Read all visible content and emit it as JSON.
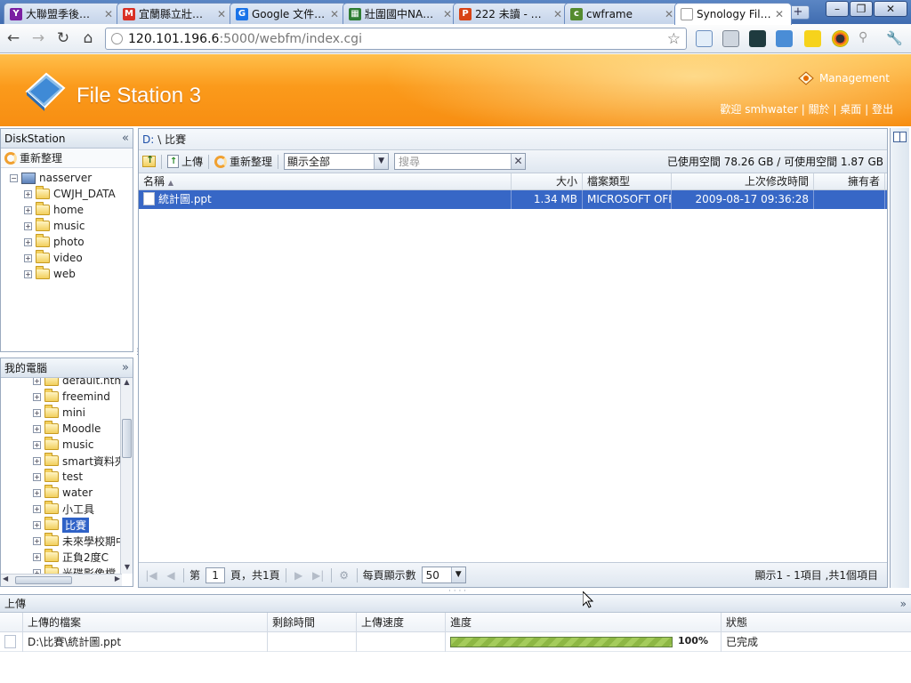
{
  "browser": {
    "tabs": [
      {
        "title": "大聯盟季後…",
        "favicon": "yahoo-icon",
        "color": "#7b1fa2"
      },
      {
        "title": "宜蘭縣立壯…",
        "favicon": "gmail-icon",
        "color": "#d93025"
      },
      {
        "title": "Google 文件…",
        "favicon": "google-docs-icon",
        "color": "#1a73e8"
      },
      {
        "title": "壯圍國中NA…",
        "favicon": "spreadsheet-icon",
        "color": "#2e7d32"
      },
      {
        "title": "222 未讀 - …",
        "favicon": "plurk-icon",
        "color": "#d84315"
      },
      {
        "title": "cwframe",
        "favicon": "cw-icon",
        "color": "#558b2f"
      },
      {
        "title": "Synology Fil…",
        "favicon": "page-icon",
        "color": "#9e9e9e"
      }
    ],
    "url_host": "120.101.196.6",
    "url_rest": ":5000/webfm/index.cgi"
  },
  "header": {
    "app_title": "File Station 3",
    "management_label": "Management",
    "welcome": "歡迎 smhwater",
    "about": "關於",
    "desktop": "桌面",
    "logout": "登出"
  },
  "left": {
    "diskstation_title": "DiskStation",
    "refresh_label": "重新整理",
    "root": "nasserver",
    "shares": [
      "CWJH_DATA",
      "home",
      "music",
      "photo",
      "video",
      "web"
    ],
    "mycomputer_title": "我的電腦",
    "local_folders": [
      "default.html_",
      "freemind",
      "mini",
      "Moodle",
      "music",
      "smart資料夾",
      "test",
      "water",
      "小工具",
      "比賽",
      "未來學校期中",
      "正負2度C",
      "光碟影像檔"
    ],
    "selected_local": "比賽"
  },
  "main": {
    "drive": "D:",
    "path": "\\ 比賽",
    "upload_label": "上傳",
    "refresh_label": "重新整理",
    "filter_value": "顯示全部",
    "search_placeholder": "搜尋",
    "space": "已使用空間 78.26 GB / 可使用空間 1.87 GB",
    "columns": {
      "name": "名稱",
      "size": "大小",
      "type": "檔案類型",
      "modified": "上次修改時間",
      "owner": "擁有者"
    },
    "files": [
      {
        "name": "統計圖.ppt",
        "size": "1.34 MB",
        "type": "MICROSOFT OFFICE",
        "modified": "2009-08-17 09:36:28",
        "owner": ""
      }
    ],
    "pager": {
      "page_prefix": "第",
      "page": "1",
      "page_suffix": "頁，共1頁",
      "per_page_label": "每頁顯示數",
      "per_page": "50",
      "summary": "顯示1 - 1項目 ,共1個項目"
    }
  },
  "upload_panel": {
    "title": "上傳",
    "columns": {
      "file": "上傳的檔案",
      "remaining": "剩餘時間",
      "speed": "上傳速度",
      "progress": "進度",
      "status": "狀態"
    },
    "rows": [
      {
        "file": "D:\\比賽\\統計圖.ppt",
        "remaining": "",
        "speed": "",
        "progress": 100,
        "progress_text": "100%",
        "status": "已完成"
      }
    ]
  }
}
